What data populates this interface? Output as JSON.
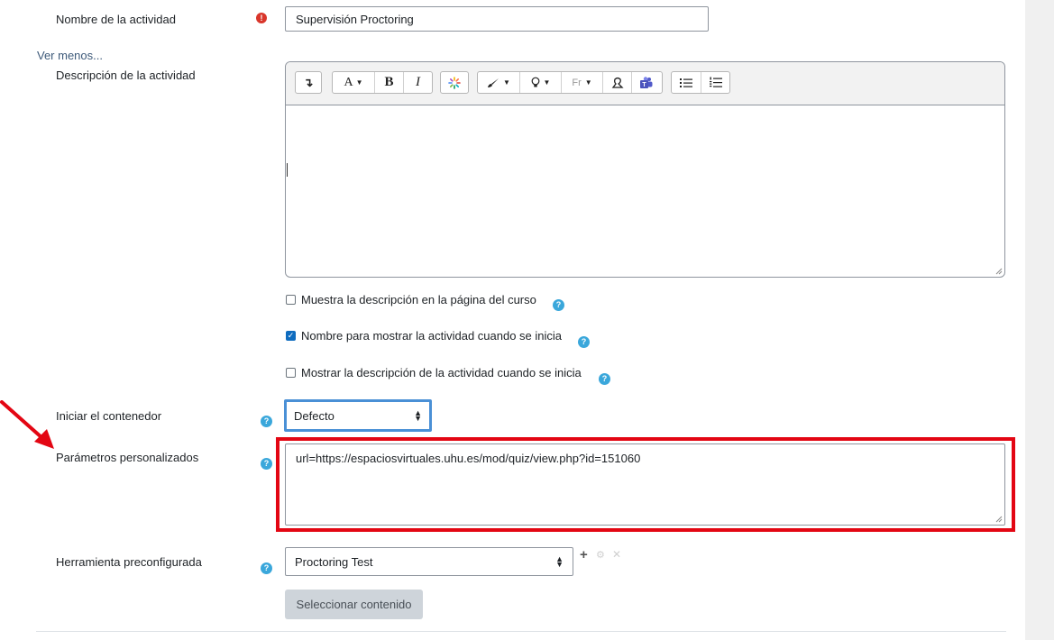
{
  "form": {
    "name_label": "Nombre de la actividad",
    "name_value": "Supervisión Proctoring",
    "required_icon": "exclamation-circle-icon",
    "toggle_link": "Ver menos...",
    "description_label": "Descripción de la actividad",
    "editor_toolbar": {
      "icons": [
        "undo-arrow-icon",
        "font-size-icon",
        "bold-icon",
        "italic-icon",
        "sparkle-icon",
        "brush-icon",
        "lightbulb-icon",
        "font-family-icon",
        "stamp-icon",
        "teams-icon",
        "bullet-list-icon",
        "numbered-list-icon"
      ],
      "bold": "B",
      "italic": "I",
      "font_size": "A",
      "font_family": "Fr"
    },
    "checkboxes": [
      {
        "label": "Muestra la descripción en la página del curso",
        "checked": false
      },
      {
        "label": "Nombre para mostrar la actividad cuando se inicia",
        "checked": true
      },
      {
        "label": "Mostrar la descripción de la actividad cuando se inicia",
        "checked": false
      }
    ],
    "container_label": "Iniciar el contenedor",
    "container_value": "Defecto",
    "custom_params_label": "Parámetros personalizados",
    "custom_params_value": "url=https://espaciosvirtuales.uhu.es/mod/quiz/view.php?id=151060",
    "tool_label": "Herramienta preconfigurada",
    "tool_value": "Proctoring Test",
    "select_content_button": "Seleccionar contenido",
    "help_icon": "?"
  },
  "colors": {
    "highlight_box": "#e30613",
    "arrow": "#e30613",
    "help": "#3aa7db",
    "focus": "#4a90d6"
  }
}
